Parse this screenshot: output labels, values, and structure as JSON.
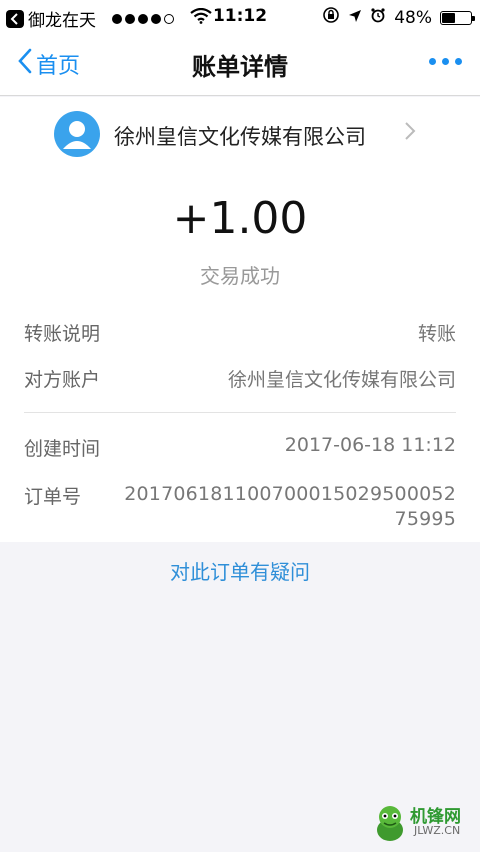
{
  "status_bar": {
    "carrier": "御龙在天",
    "time": "11:12",
    "battery_percent": "48%",
    "battery_level": 0.48,
    "signal_bars_filled": 4,
    "signal_bars_total": 5
  },
  "nav": {
    "back_label": "首页",
    "title": "账单详情"
  },
  "payee": {
    "name": "徐州皇信文化传媒有限公司"
  },
  "transaction": {
    "amount": "+1.00",
    "status": "交易成功"
  },
  "details": [
    {
      "label": "转账说明",
      "value": "转账"
    },
    {
      "label": "对方账户",
      "value": "徐州皇信文化传媒有限公司"
    },
    {
      "label": "创建时间",
      "value": "2017-06-18 11:12"
    },
    {
      "label": "订单号",
      "value": "2017061811007000150295000527​5995"
    }
  ],
  "actions": {
    "question_label": "对此订单有疑问"
  },
  "watermark": {
    "text": "机锋网",
    "sub": "JLWZ.CN"
  },
  "colors": {
    "accent": "#1a8ff0",
    "avatar": "#3aa3ec",
    "background": "#f4f4f8"
  }
}
